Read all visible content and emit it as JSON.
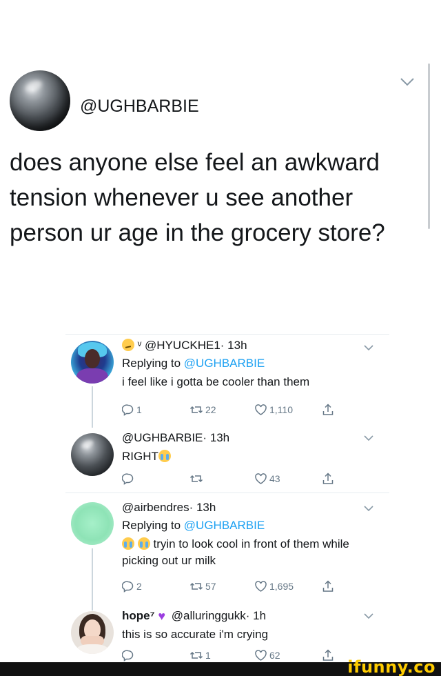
{
  "main_tweet": {
    "handle": "@UGHBARBIE",
    "text": "does anyone else feel an awkward tension whenever u see another person ur age in the grocery store?"
  },
  "replies": [
    {
      "header_prefix_badge": "ᵛ",
      "handle": "@HYUCKHE1",
      "time": "· 13h",
      "replying_label": "Replying to",
      "replying_to": "@UGHBARBIE",
      "text": "i feel like i gotta be cooler than them",
      "reply_count": "1",
      "retweet_count": "22",
      "like_count": "1,110"
    },
    {
      "handle": "@UGHBARBIE",
      "time": "· 13h",
      "text": "RIGHT",
      "reply_count": "",
      "retweet_count": "",
      "like_count": "43"
    },
    {
      "handle": "@airbendres",
      "time": "· 13h",
      "replying_label": "Replying to",
      "replying_to": "@UGHBARBIE",
      "text": "tryin to look cool in front of them while picking out ur milk",
      "reply_count": "2",
      "retweet_count": "57",
      "like_count": "1,695"
    },
    {
      "name": "hope⁷",
      "handle": "@alluringgukk",
      "time": "· 1h",
      "text": "this is so accurate i'm crying",
      "reply_count": "",
      "retweet_count": "1",
      "like_count": "62"
    }
  ],
  "footer": {
    "logo": "ifunny.co"
  },
  "colors": {
    "link": "#1da1f2",
    "meta": "#657786",
    "thread_line": "#ccd6dd",
    "footer_bg": "#111111",
    "logo": "#ffcc00"
  },
  "icons": [
    "chevron-down-icon",
    "reply-icon",
    "retweet-icon",
    "like-icon",
    "share-icon",
    "purple-heart-icon",
    "crying-face-icon",
    "smirk-face-icon"
  ]
}
